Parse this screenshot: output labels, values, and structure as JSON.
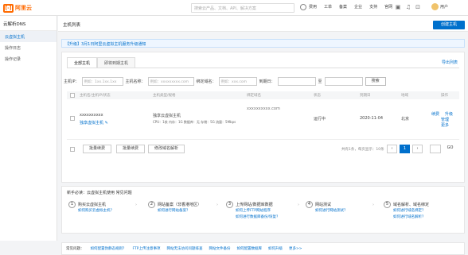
{
  "topbar": {
    "logo_text": "阿里云",
    "search_placeholder": "搜索云产品、文档、API、解决方案",
    "nav": [
      "费用",
      "工单",
      "备案",
      "企业",
      "支持",
      "官网"
    ],
    "user": "用户"
  },
  "sidebar": {
    "title": "云解析DNS",
    "items": [
      "云虚拟主机",
      "操作日志",
      "操作记录"
    ]
  },
  "page": {
    "title": "主机列表",
    "create_label": "创建主机",
    "notice": "【升级】3月1日阿里云虚拟主机服务升级通知"
  },
  "tabs": [
    "全部主机",
    "即将到期主机"
  ],
  "export_label": "导出列表",
  "filters": {
    "ip_label": "主机IP：",
    "ip_placeholder": "例如：1xx.1xx.1xx",
    "name_label": "主机名称：",
    "name_placeholder": "例如：xxxxxxxxx.com",
    "domain_label": "绑定域名：",
    "domain_placeholder": "例如：xxx.com",
    "expire_label": "到期日：",
    "to_label": "至",
    "query_label": "搜索"
  },
  "table": {
    "headers": [
      "主机名/主机IP/状态",
      "主机类型/规格",
      "绑定域名",
      "状态",
      "到期日",
      "地域",
      "操作"
    ],
    "rows": [
      {
        "name": "xxxxxxxxxx",
        "sub": "独享虚拟主机 ✎",
        "type": "独享云虚拟主机",
        "spec": "CPU：1核 内存：1G 数据库：无 存储：5G 流量：5Mbps",
        "domain": "xxxxxxxxxx.com",
        "status": "运行中",
        "expire": "2020-11-04",
        "region": "北京",
        "actions": [
          "续费",
          "升级",
          "管理",
          "更多"
        ]
      }
    ]
  },
  "footer": {
    "buttons": [
      "批量续费",
      "批量续费",
      "修改域名解析"
    ],
    "pager_text": "共有1条，每页显示：10条",
    "pages": [
      "‹",
      "1",
      "›"
    ],
    "goto_label": "GO"
  },
  "guide": {
    "title": "新手必读：云虚拟主机使用  常见问题",
    "steps": [
      {
        "n": "1",
        "t": "购买云虚拟主机",
        "l": [
          "如何购买云虚拟主机？"
        ]
      },
      {
        "n": "2",
        "t": "网站备案（非香港地区）",
        "l": [
          "如何进行网站备案？"
        ]
      },
      {
        "n": "3",
        "t": "上传网站/数据库数据",
        "l": [
          "如何上传FTP网站程序",
          "如何进行数据库备份/恢复？"
        ]
      },
      {
        "n": "4",
        "t": "网站测试",
        "l": [
          "如何进行网站测试？"
        ]
      },
      {
        "n": "5",
        "t": "域名解析、域名绑定",
        "l": [
          "如何进行域名绑定？",
          "如何进行域名解析？"
        ]
      }
    ]
  },
  "faq": {
    "label": "常见问题：",
    "items": [
      "如何配置伪静态规则？",
      "FTP上传注意事项",
      "网站无法访问问题排查",
      "网站文件备份",
      "如何配置数据库",
      "如何升级",
      "更多>>"
    ]
  },
  "colors": {
    "accent": "#0070cc",
    "brand": "#ff6a00"
  }
}
